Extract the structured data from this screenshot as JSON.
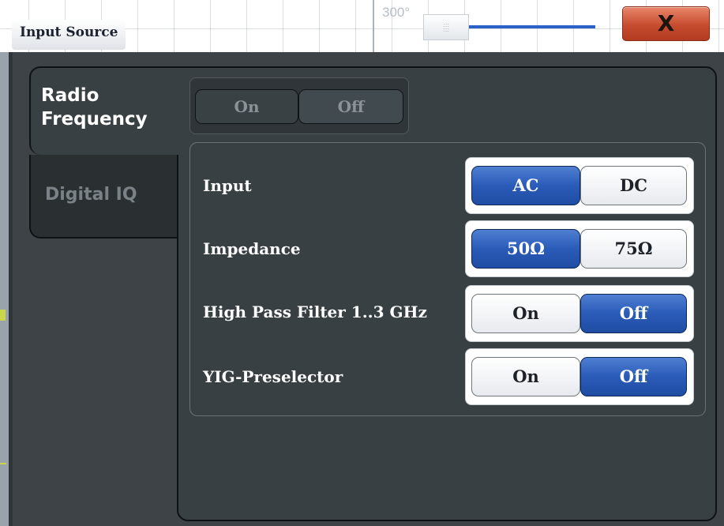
{
  "window": {
    "title": "Input Source",
    "close_label": "X",
    "background_angle": "300°"
  },
  "tabs": [
    {
      "label": "Radio\nFrequency",
      "selected": true
    },
    {
      "label": "Digital IQ",
      "selected": false
    }
  ],
  "radio_frequency": {
    "state": {
      "on_label": "On",
      "off_label": "Off",
      "selected": "none"
    },
    "settings": [
      {
        "label": "Input",
        "options": [
          "AC",
          "DC"
        ],
        "selected": "AC"
      },
      {
        "label": "Impedance",
        "options": [
          "50Ω",
          "75Ω"
        ],
        "selected": "50Ω"
      },
      {
        "label": "High Pass Filter 1..3 GHz",
        "options": [
          "On",
          "Off"
        ],
        "selected": "Off"
      },
      {
        "label": "YIG-Preselector",
        "options": [
          "On",
          "Off"
        ],
        "selected": "Off"
      }
    ]
  },
  "colors": {
    "active_button": "#2a5bb8",
    "close_button": "#c64c2e",
    "dialog_background": "#394044"
  }
}
